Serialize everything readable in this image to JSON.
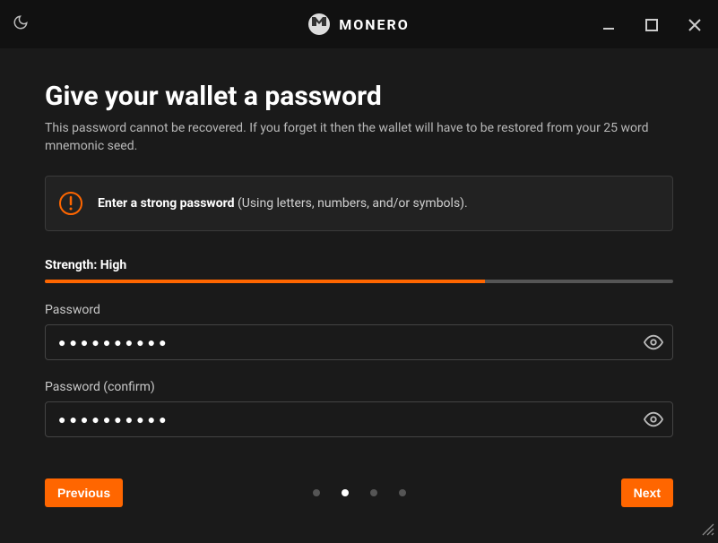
{
  "titlebar": {
    "brand": "MONERO"
  },
  "heading": "Give your wallet a password",
  "subheading": "This password cannot be recovered. If you forget it then the wallet will have to be restored from your 25 word mnemonic seed.",
  "infobox": {
    "strong_text": "Enter a strong password",
    "rest_text": " (Using letters, numbers, and/or symbols)."
  },
  "strength": {
    "label": "Strength: High",
    "percent": 70
  },
  "fields": {
    "password_label": "Password",
    "password_value": "●●●●●●●●●●",
    "confirm_label": "Password (confirm)",
    "confirm_value": "●●●●●●●●●●"
  },
  "buttons": {
    "previous": "Previous",
    "next": "Next"
  },
  "pager": {
    "total": 4,
    "active_index": 1
  }
}
